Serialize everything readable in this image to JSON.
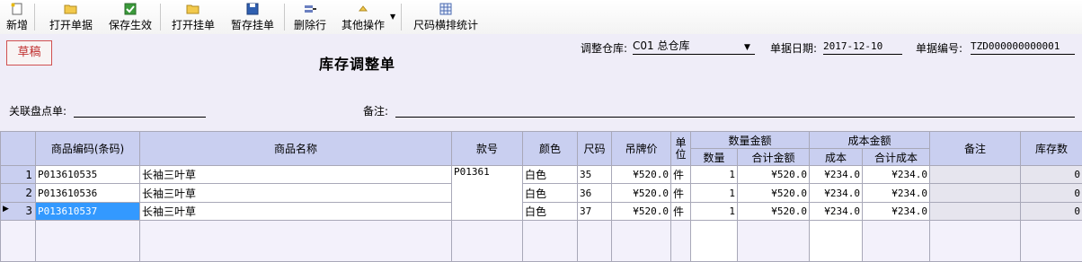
{
  "toolbar": {
    "new": "新增",
    "open_doc": "打开单据",
    "save_effective": "保存生效",
    "open_held": "打开挂单",
    "hold": "暂存挂单",
    "delete_row": "删除行",
    "other_ops": "其他操作",
    "size_stats": "尺码横排统计"
  },
  "form": {
    "status": "草稿",
    "title": "库存调整单",
    "warehouse_label": "调整仓库:",
    "warehouse_value": "C01 总仓库",
    "date_label": "单据日期:",
    "date_value": "2017-12-10",
    "docno_label": "单据编号:",
    "docno_value": "TZD000000000001",
    "linked_label": "关联盘点单:",
    "linked_value": "",
    "remark_label": "备注:",
    "remark_value": ""
  },
  "grid": {
    "headers": {
      "code": "商品编码(条码)",
      "name": "商品名称",
      "style": "款号",
      "color": "颜色",
      "size": "尺码",
      "tag_price": "吊牌价",
      "unit": "单位",
      "qty_amount": "数量金额",
      "qty": "数量",
      "total_amount": "合计金额",
      "cost_amount": "成本金额",
      "cost": "成本",
      "total_cost": "合计成本",
      "remark": "备注",
      "stock": "库存数"
    },
    "rows": [
      {
        "idx": "1",
        "code": "P013610535",
        "name": "长袖三叶草",
        "style": "P01361",
        "color": "白色",
        "size": "35",
        "price": "¥520.0",
        "unit": "件",
        "qty": "1",
        "amount": "¥520.0",
        "cost": "¥234.0",
        "total_cost": "¥234.0",
        "remark": "",
        "stock": "0"
      },
      {
        "idx": "2",
        "code": "P013610536",
        "name": "长袖三叶草",
        "style": "",
        "color": "白色",
        "size": "36",
        "price": "¥520.0",
        "unit": "件",
        "qty": "1",
        "amount": "¥520.0",
        "cost": "¥234.0",
        "total_cost": "¥234.0",
        "remark": "",
        "stock": "0"
      },
      {
        "idx": "3",
        "code": "P013610537",
        "name": "长袖三叶草",
        "style": "",
        "color": "白色",
        "size": "37",
        "price": "¥520.0",
        "unit": "件",
        "qty": "1",
        "amount": "¥520.0",
        "cost": "¥234.0",
        "total_cost": "¥234.0",
        "remark": "",
        "stock": "0"
      }
    ]
  },
  "icons": {
    "new": "new-document-icon",
    "open_doc": "folder-icon",
    "save_effective": "save-check-icon",
    "open_held": "folder-icon",
    "hold": "floppy-disk-icon",
    "delete_row": "delete-row-icon",
    "other_ops": "menu-icon",
    "size_stats": "table-grid-icon"
  },
  "colors": {
    "header_bg": "#c9cff0",
    "selected_cell": "#3399ff",
    "draft_border": "#d05050"
  }
}
